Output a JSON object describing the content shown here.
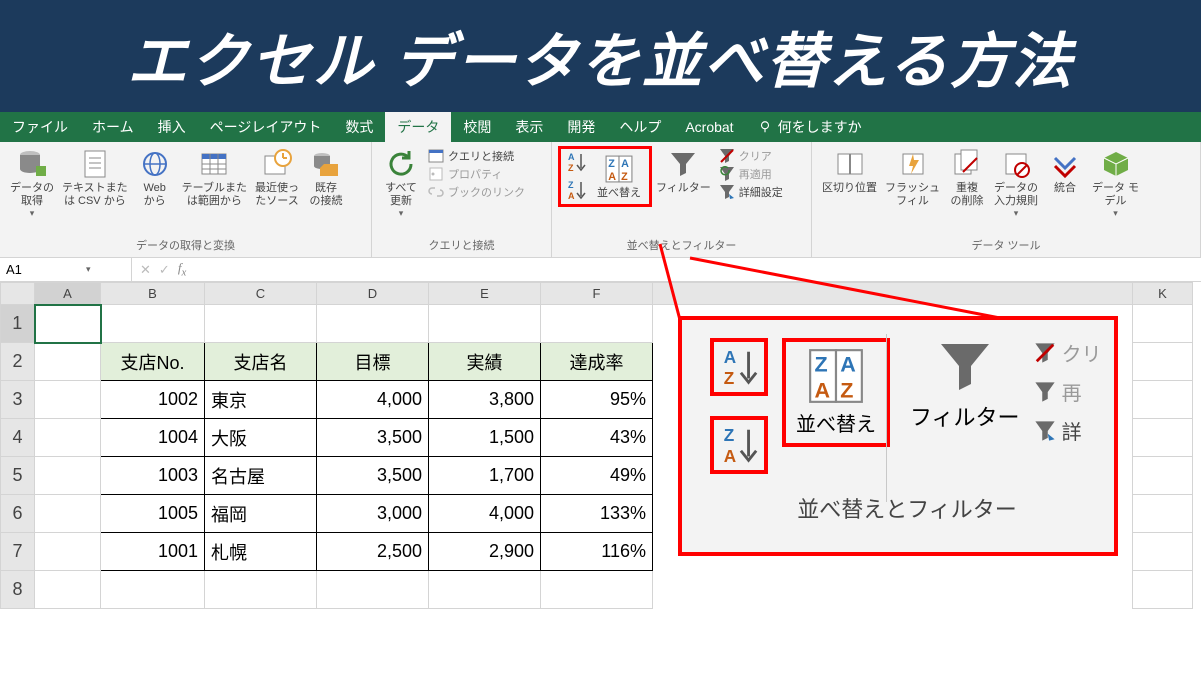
{
  "banner": {
    "title": "エクセル データを並べ替える方法"
  },
  "tabs": {
    "items": [
      "ファイル",
      "ホーム",
      "挿入",
      "ページレイアウト",
      "数式",
      "データ",
      "校閲",
      "表示",
      "開発",
      "ヘルプ",
      "Acrobat"
    ],
    "active_index": 5,
    "tellme": "何をしますか"
  },
  "ribbon": {
    "groups": {
      "get_transform": {
        "label": "データの取得と変換",
        "buttons": {
          "get_data": "データの\n取得",
          "from_csv": "テキストまた\nは CSV から",
          "from_web": "Web\nから",
          "from_table": "テーブルまた\nは範囲から",
          "recent": "最近使っ\nたソース",
          "existing": "既存\nの接続"
        }
      },
      "queries": {
        "label": "クエリと接続",
        "refresh_all": "すべて\n更新",
        "items": {
          "qc": "クエリと接続",
          "prop": "プロパティ",
          "links": "ブックのリンク"
        }
      },
      "sort_filter": {
        "label": "並べ替えとフィルター",
        "sort": "並べ替え",
        "filter": "フィルター",
        "clear": "クリア",
        "reapply": "再適用",
        "advanced": "詳細設定"
      },
      "data_tools": {
        "label": "データ ツール",
        "text_to_cols": "区切り位置",
        "flash_fill": "フラッシュ\nフィル",
        "remove_dup": "重複\nの削除",
        "data_val": "データの\n入力規則",
        "consolidate": "統合",
        "data_model": "データ モ\nデル"
      }
    }
  },
  "namebox": {
    "value": "A1"
  },
  "columns": [
    "A",
    "B",
    "C",
    "D",
    "E",
    "F",
    "K"
  ],
  "row_numbers": [
    1,
    2,
    3,
    4,
    5,
    6,
    7,
    8
  ],
  "table": {
    "headers": [
      "支店No.",
      "支店名",
      "目標",
      "実績",
      "達成率"
    ],
    "rows": [
      {
        "no": "1002",
        "name": "東京",
        "goal": "4,000",
        "actual": "3,800",
        "rate": "95%"
      },
      {
        "no": "1004",
        "name": "大阪",
        "goal": "3,500",
        "actual": "1,500",
        "rate": "43%"
      },
      {
        "no": "1003",
        "name": "名古屋",
        "goal": "3,500",
        "actual": "1,700",
        "rate": "49%"
      },
      {
        "no": "1005",
        "name": "福岡",
        "goal": "3,000",
        "actual": "4,000",
        "rate": "133%"
      },
      {
        "no": "1001",
        "name": "札幌",
        "goal": "2,500",
        "actual": "2,900",
        "rate": "116%"
      }
    ]
  },
  "callout": {
    "sort": "並べ替え",
    "filter": "フィルター",
    "clear": "クリ",
    "reapply": "再",
    "advanced": "詳",
    "group_label": "並べ替えとフィルター"
  }
}
